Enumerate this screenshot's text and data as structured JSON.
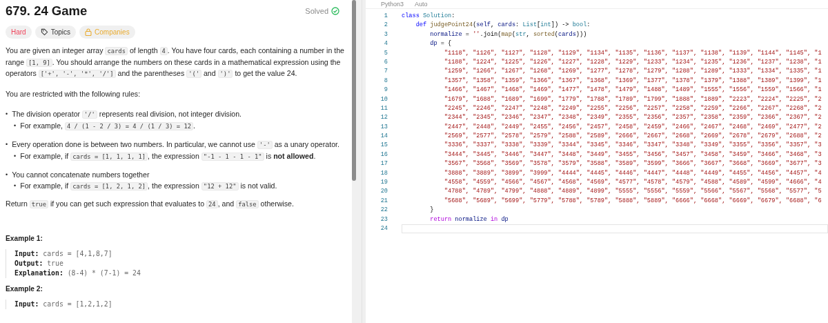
{
  "problem": {
    "title": "679. 24 Game",
    "status": "Solved",
    "tags": [
      {
        "kind": "difficulty",
        "label": "Hard"
      },
      {
        "kind": "topics",
        "label": "Topics"
      },
      {
        "kind": "companies",
        "label": "Companies"
      }
    ],
    "blocks": [
      {
        "kind": "paragraph",
        "segments": [
          {
            "kind": "text",
            "text": "You are given an integer array "
          },
          {
            "kind": "code",
            "text": "cards"
          },
          {
            "kind": "text",
            "text": " of length "
          },
          {
            "kind": "code",
            "text": "4"
          },
          {
            "kind": "text",
            "text": ". You have four cards, each containing a number in the range "
          },
          {
            "kind": "code",
            "text": "[1, 9]"
          },
          {
            "kind": "text",
            "text": ". You should arrange the numbers on these cards in a mathematical expression using the operators "
          },
          {
            "kind": "code",
            "text": "['+', '-', '*', '/']"
          },
          {
            "kind": "text",
            "text": " and the parentheses "
          },
          {
            "kind": "code",
            "text": "'('"
          },
          {
            "kind": "text",
            "text": " and "
          },
          {
            "kind": "code",
            "text": "')'"
          },
          {
            "kind": "text",
            "text": " to get the value 24."
          }
        ]
      },
      {
        "kind": "paragraph",
        "segments": [
          {
            "kind": "text",
            "text": "You are restricted with the following rules:"
          }
        ]
      },
      {
        "kind": "bullet",
        "marker": "•",
        "segments": [
          {
            "kind": "text",
            "text": "The division operator "
          },
          {
            "kind": "code",
            "text": "'/'"
          },
          {
            "kind": "text",
            "text": " represents real division, not integer division."
          }
        ],
        "children": [
          {
            "marker": "•",
            "segments": [
              {
                "kind": "text",
                "text": "For example, "
              },
              {
                "kind": "code",
                "text": "4 / (1 - 2 / 3) = 4 / (1 / 3) = 12"
              },
              {
                "kind": "text",
                "text": "."
              }
            ]
          }
        ]
      },
      {
        "kind": "bullet",
        "marker": "•",
        "segments": [
          {
            "kind": "text",
            "text": "Every operation done is between two numbers. In particular, we cannot use "
          },
          {
            "kind": "code",
            "text": "'-'"
          },
          {
            "kind": "text",
            "text": " as a unary operator."
          }
        ],
        "children": [
          {
            "marker": "•",
            "segments": [
              {
                "kind": "text",
                "text": "For example, if "
              },
              {
                "kind": "code",
                "text": "cards = [1, 1, 1, 1]"
              },
              {
                "kind": "text",
                "text": ", the expression "
              },
              {
                "kind": "code",
                "text": "\"-1 - 1 - 1 - 1\""
              },
              {
                "kind": "text",
                "text": " is "
              },
              {
                "kind": "bold",
                "text": "not allowed"
              },
              {
                "kind": "text",
                "text": "."
              }
            ]
          }
        ]
      },
      {
        "kind": "bullet",
        "marker": "•",
        "segments": [
          {
            "kind": "text",
            "text": "You cannot concatenate numbers together"
          }
        ],
        "children": [
          {
            "marker": "•",
            "segments": [
              {
                "kind": "text",
                "text": "For example, if "
              },
              {
                "kind": "code",
                "text": "cards = [1, 2, 1, 2]"
              },
              {
                "kind": "text",
                "text": ", the expression "
              },
              {
                "kind": "code",
                "text": "\"12 + 12\""
              },
              {
                "kind": "text",
                "text": " is not valid."
              }
            ]
          }
        ]
      },
      {
        "kind": "paragraph",
        "segments": [
          {
            "kind": "text",
            "text": "Return "
          },
          {
            "kind": "code",
            "text": "true"
          },
          {
            "kind": "text",
            "text": " if you can get such expression that evaluates to "
          },
          {
            "kind": "code",
            "text": "24"
          },
          {
            "kind": "text",
            "text": ", and "
          },
          {
            "kind": "code",
            "text": "false"
          },
          {
            "kind": "text",
            "text": " otherwise."
          }
        ]
      }
    ],
    "examples": [
      {
        "title": "Example 1:",
        "lines": [
          {
            "label": "Input:",
            "value": "cards = [4,1,8,7]"
          },
          {
            "label": "Output:",
            "value": "true"
          },
          {
            "label": "Explanation:",
            "value": "(8-4) * (7-1) = 24"
          }
        ]
      },
      {
        "title": "Example 2:",
        "lines": [
          {
            "label": "Input:",
            "value": "cards = [1,2,1,2]"
          }
        ]
      }
    ]
  },
  "editor": {
    "language": "Python3",
    "mode": "Auto",
    "lines": [
      {
        "number": "1",
        "active": false,
        "tokens": [
          {
            "kind": "keyword",
            "text": "class"
          },
          {
            "kind": "type",
            "text": " Solution"
          },
          {
            "kind": "plain",
            "text": ":"
          }
        ]
      },
      {
        "number": "2",
        "active": false,
        "tokens": [
          {
            "kind": "keyword",
            "text": "    def"
          },
          {
            "kind": "func",
            "text": " judgePoint24"
          },
          {
            "kind": "plain",
            "text": "("
          },
          {
            "kind": "var",
            "text": "self"
          },
          {
            "kind": "plain",
            "text": ", "
          },
          {
            "kind": "var",
            "text": "cards"
          },
          {
            "kind": "plain",
            "text": ": "
          },
          {
            "kind": "type",
            "text": "List"
          },
          {
            "kind": "plain",
            "text": "["
          },
          {
            "kind": "type",
            "text": "int"
          },
          {
            "kind": "plain",
            "text": "]) -> "
          },
          {
            "kind": "type",
            "text": "bool"
          },
          {
            "kind": "plain",
            "text": ":"
          }
        ]
      },
      {
        "number": "3",
        "active": false,
        "tokens": [
          {
            "kind": "var",
            "text": "        normalize"
          },
          {
            "kind": "plain",
            "text": " = "
          },
          {
            "kind": "string",
            "text": "''"
          },
          {
            "kind": "plain",
            "text": ".join("
          },
          {
            "kind": "func",
            "text": "map"
          },
          {
            "kind": "plain",
            "text": "("
          },
          {
            "kind": "type",
            "text": "str"
          },
          {
            "kind": "plain",
            "text": ", "
          },
          {
            "kind": "func",
            "text": "sorted"
          },
          {
            "kind": "plain",
            "text": "("
          },
          {
            "kind": "var",
            "text": "cards"
          },
          {
            "kind": "plain",
            "text": ")))"
          }
        ]
      },
      {
        "number": "4",
        "active": false,
        "tokens": [
          {
            "kind": "var",
            "text": "        dp"
          },
          {
            "kind": "plain",
            "text": " = {"
          }
        ]
      },
      {
        "number": "5",
        "active": false,
        "tokens": [
          {
            "kind": "string",
            "text": "            \"1118\", \"1126\", \"1127\", \"1128\", \"1129\", \"1134\", \"1135\", \"1136\", \"1137\", \"1138\", \"1139\", \"1144\", \"1145\", \"1"
          }
        ]
      },
      {
        "number": "6",
        "active": false,
        "tokens": [
          {
            "kind": "string",
            "text": "            \"1188\", \"1224\", \"1225\", \"1226\", \"1227\", \"1228\", \"1229\", \"1233\", \"1234\", \"1235\", \"1236\", \"1237\", \"1238\", \"1"
          }
        ]
      },
      {
        "number": "7",
        "active": false,
        "tokens": [
          {
            "kind": "string",
            "text": "            \"1259\", \"1266\", \"1267\", \"1268\", \"1269\", \"1277\", \"1278\", \"1279\", \"1288\", \"1289\", \"1333\", \"1334\", \"1335\", \"1"
          }
        ]
      },
      {
        "number": "8",
        "active": false,
        "tokens": [
          {
            "kind": "string",
            "text": "            \"1357\", \"1358\", \"1359\", \"1366\", \"1367\", \"1368\", \"1369\", \"1377\", \"1378\", \"1379\", \"1388\", \"1389\", \"1399\", \"1"
          }
        ]
      },
      {
        "number": "9",
        "active": false,
        "tokens": [
          {
            "kind": "string",
            "text": "            \"1466\", \"1467\", \"1468\", \"1469\", \"1477\", \"1478\", \"1479\", \"1488\", \"1489\", \"1555\", \"1556\", \"1559\", \"1566\", \"1"
          }
        ]
      },
      {
        "number": "10",
        "active": false,
        "tokens": [
          {
            "kind": "string",
            "text": "            \"1679\", \"1688\", \"1689\", \"1699\", \"1779\", \"1788\", \"1789\", \"1799\", \"1888\", \"1889\", \"2223\", \"2224\", \"2225\", \"2"
          }
        ]
      },
      {
        "number": "11",
        "active": false,
        "tokens": [
          {
            "kind": "string",
            "text": "            \"2245\", \"2246\", \"2247\", \"2248\", \"2249\", \"2255\", \"2256\", \"2257\", \"2258\", \"2259\", \"2266\", \"2267\", \"2268\", \"2"
          }
        ]
      },
      {
        "number": "12",
        "active": false,
        "tokens": [
          {
            "kind": "string",
            "text": "            \"2344\", \"2345\", \"2346\", \"2347\", \"2348\", \"2349\", \"2355\", \"2356\", \"2357\", \"2358\", \"2359\", \"2366\", \"2367\", \"2"
          }
        ]
      },
      {
        "number": "13",
        "active": false,
        "tokens": [
          {
            "kind": "string",
            "text": "            \"2447\", \"2448\", \"2449\", \"2455\", \"2456\", \"2457\", \"2458\", \"2459\", \"2466\", \"2467\", \"2468\", \"2469\", \"2477\", \"2"
          }
        ]
      },
      {
        "number": "14",
        "active": false,
        "tokens": [
          {
            "kind": "string",
            "text": "            \"2569\", \"2577\", \"2578\", \"2579\", \"2588\", \"2589\", \"2666\", \"2667\", \"2668\", \"2669\", \"2678\", \"2679\", \"2688\", \"2"
          }
        ]
      },
      {
        "number": "15",
        "active": false,
        "tokens": [
          {
            "kind": "string",
            "text": "            \"3336\", \"3337\", \"3338\", \"3339\", \"3344\", \"3345\", \"3346\", \"3347\", \"3348\", \"3349\", \"3355\", \"3356\", \"3357\", \"3"
          }
        ]
      },
      {
        "number": "16",
        "active": false,
        "tokens": [
          {
            "kind": "string",
            "text": "            \"3444\", \"3445\", \"3446\", \"3447\", \"3448\", \"3449\", \"3455\", \"3456\", \"3457\", \"3458\", \"3459\", \"3466\", \"3468\", \"3"
          }
        ]
      },
      {
        "number": "17",
        "active": false,
        "tokens": [
          {
            "kind": "string",
            "text": "            \"3567\", \"3568\", \"3569\", \"3578\", \"3579\", \"3588\", \"3589\", \"3599\", \"3666\", \"3667\", \"3668\", \"3669\", \"3677\", \"3"
          }
        ]
      },
      {
        "number": "18",
        "active": false,
        "tokens": [
          {
            "kind": "string",
            "text": "            \"3888\", \"3889\", \"3899\", \"3999\", \"4444\", \"4445\", \"4446\", \"4447\", \"4448\", \"4449\", \"4455\", \"4456\", \"4457\", \"4"
          }
        ]
      },
      {
        "number": "19",
        "active": false,
        "tokens": [
          {
            "kind": "string",
            "text": "            \"4558\", \"4559\", \"4566\", \"4567\", \"4568\", \"4569\", \"4577\", \"4578\", \"4579\", \"4588\", \"4589\", \"4599\", \"4666\", \"4"
          }
        ]
      },
      {
        "number": "20",
        "active": false,
        "tokens": [
          {
            "kind": "string",
            "text": "            \"4788\", \"4789\", \"4799\", \"4888\", \"4889\", \"4899\", \"5555\", \"5556\", \"5559\", \"5566\", \"5567\", \"5568\", \"5577\", \"5"
          }
        ]
      },
      {
        "number": "21",
        "active": false,
        "tokens": [
          {
            "kind": "string",
            "text": "            \"5688\", \"5689\", \"5699\", \"5779\", \"5788\", \"5789\", \"5888\", \"5889\", \"6666\", \"6668\", \"6669\", \"6679\", \"6688\", \"6"
          }
        ]
      },
      {
        "number": "22",
        "active": false,
        "tokens": [
          {
            "kind": "plain",
            "text": "        }"
          }
        ]
      },
      {
        "number": "23",
        "active": false,
        "tokens": [
          {
            "kind": "control",
            "text": "        return"
          },
          {
            "kind": "var",
            "text": " normalize"
          },
          {
            "kind": "control",
            "text": " in"
          },
          {
            "kind": "var",
            "text": " dp"
          }
        ]
      },
      {
        "number": "24",
        "active": true
      }
    ]
  }
}
